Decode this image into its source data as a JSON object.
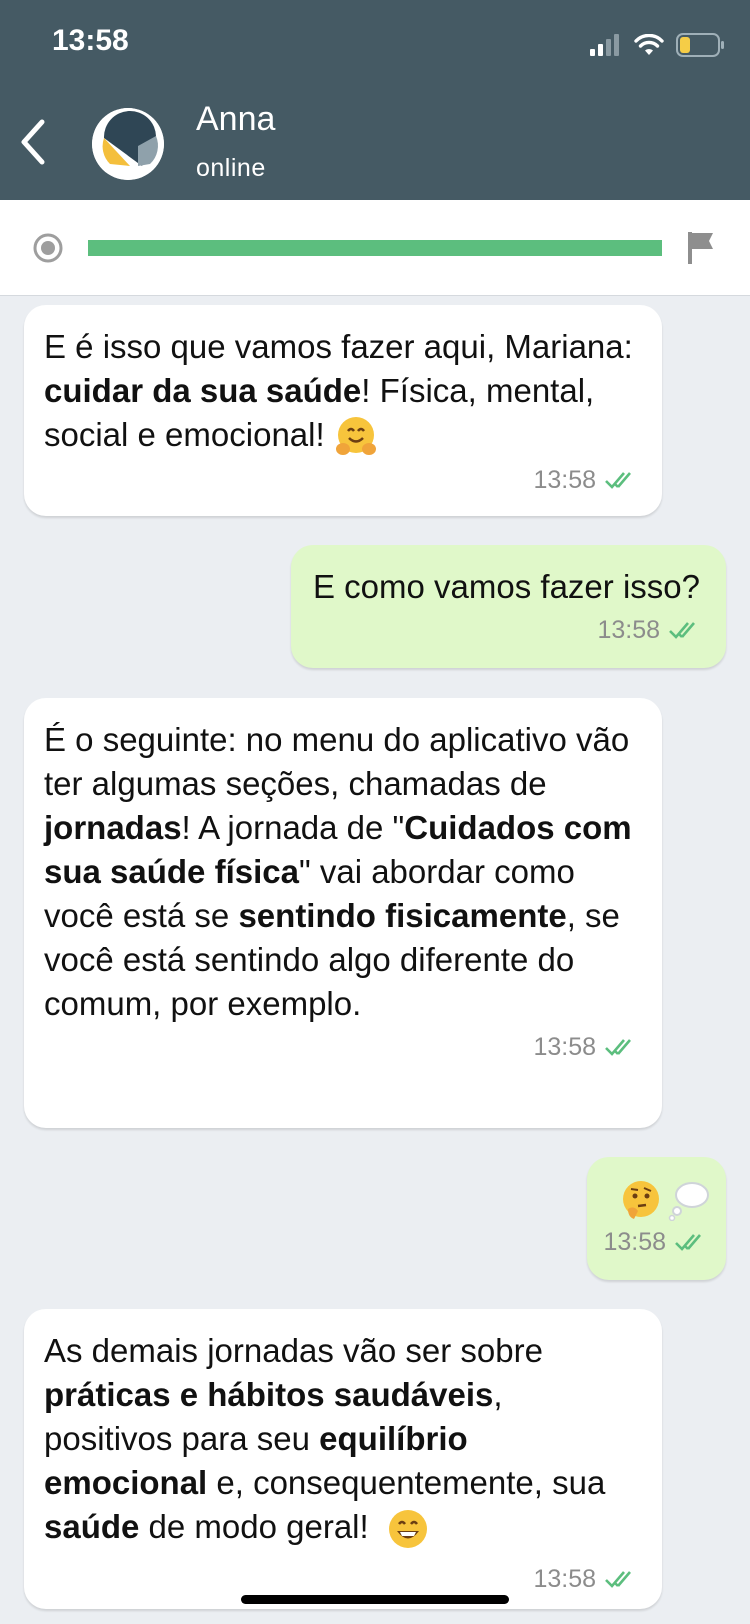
{
  "status_bar": {
    "time": "13:58",
    "battery_level": 0.25
  },
  "header": {
    "name": "Anna",
    "status": "online"
  },
  "progress": {
    "fraction": 1.0,
    "color": "#5cbe7e"
  },
  "colors": {
    "header_bg": "#455a64",
    "incoming_bubble": "#ffffff",
    "outgoing_bubble": "#e0f8c9",
    "read_ticks": "#5cbe7e"
  },
  "messages": [
    {
      "direction": "incoming",
      "segments": [
        {
          "text": "E é isso que vamos fazer aqui, Mariana: "
        },
        {
          "text": "cuidar da sua saúde",
          "bold": true
        },
        {
          "text": "! Física, mental, social e emocional!"
        }
      ],
      "emoji": "hugging-face-emoji",
      "time": "13:58"
    },
    {
      "direction": "outgoing",
      "text": "E como vamos fazer isso?",
      "time": "13:58"
    },
    {
      "direction": "incoming",
      "segments": [
        {
          "text": "É o seguinte: no menu do aplicativo vão ter algumas seções, chamadas de "
        },
        {
          "text": "jornadas",
          "bold": true
        },
        {
          "text": "! A jornada de \""
        },
        {
          "text": "Cuidados com sua saúde física",
          "bold": true
        },
        {
          "text": "\" vai abordar como você está se "
        },
        {
          "text": "sentindo fisicamente",
          "bold": true
        },
        {
          "text": ", se você está sentindo algo diferente do comum, por exemplo."
        }
      ],
      "time": "13:58"
    },
    {
      "direction": "outgoing",
      "emojis": [
        "thinking-face-emoji",
        "thought-balloon-emoji"
      ],
      "time": "13:58"
    },
    {
      "direction": "incoming",
      "segments": [
        {
          "text": "As demais jornadas vão ser sobre "
        },
        {
          "text": "práticas e hábitos saudáveis",
          "bold": true
        },
        {
          "text": ", positivos para seu "
        },
        {
          "text": "equilíbrio emocional",
          "bold": true
        },
        {
          "text": " e, consequentemente, sua "
        },
        {
          "text": "saúde",
          "bold": true
        },
        {
          "text": " de modo geral!"
        }
      ],
      "emoji": "grinning-face-emoji",
      "time": "13:58"
    }
  ]
}
